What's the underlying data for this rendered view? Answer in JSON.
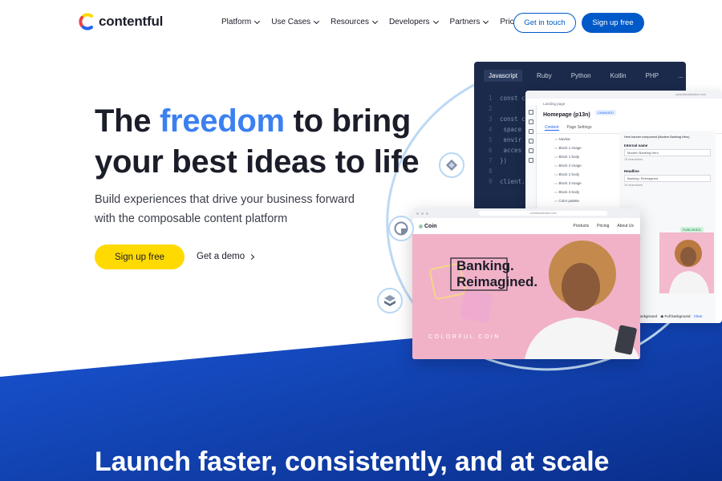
{
  "header": {
    "logo_text": "contentful",
    "nav": [
      {
        "label": "Platform",
        "dropdown": true
      },
      {
        "label": "Use Cases",
        "dropdown": true
      },
      {
        "label": "Resources",
        "dropdown": true
      },
      {
        "label": "Developers",
        "dropdown": true
      },
      {
        "label": "Partners",
        "dropdown": true
      },
      {
        "label": "Pricing",
        "dropdown": false
      }
    ],
    "get_in_touch": "Get in touch",
    "sign_up": "Sign up free"
  },
  "hero": {
    "headline_pre": "The ",
    "headline_highlight": "freedom",
    "headline_post_line1": " to bring",
    "headline_line2": "your best ideas to life",
    "subtext": "Build experiences that drive your business forward with the composable content platform",
    "cta_primary": "Sign up free",
    "cta_secondary": "Get a demo"
  },
  "code_window": {
    "tabs": [
      "Javascript",
      "Ruby",
      "Python",
      "Kotlin",
      "PHP",
      "..."
    ],
    "active_tab": "Javascript",
    "lines": [
      {
        "n": "1",
        "code": "const c"
      },
      {
        "n": "2",
        "code": ""
      },
      {
        "n": "3",
        "code": "const c"
      },
      {
        "n": "4",
        "code": "  space"
      },
      {
        "n": "5",
        "code": "  envir"
      },
      {
        "n": "6",
        "code": "  acces"
      },
      {
        "n": "7",
        "code": "})"
      },
      {
        "n": "8",
        "code": ""
      },
      {
        "n": "9",
        "code": "client."
      }
    ]
  },
  "cms": {
    "url": "colorfulcollective.com",
    "breadcrumb": "Landing page",
    "title": "Homepage (p13n)",
    "badge": "CHANGED",
    "tabs": [
      "Content",
      "Page Settings"
    ],
    "list": [
      "Navbar",
      "Block 1 image",
      "Block 1 body",
      "Block 2 image",
      "Block 2 body",
      "Block 3 image",
      "Block 3 body",
      "Color palette"
    ],
    "component_title": "Hero banner component (Modern Banking Hero)",
    "fields": [
      {
        "label": "Internal name",
        "value": "Modern Banking Hero",
        "hint": "19 characters"
      },
      {
        "label": "Headline",
        "value": "Banking. Reimagined",
        "hint": "19 characters"
      }
    ],
    "published_badge": "PUBLISHED",
    "background_label": "Background",
    "full_background": "Full background",
    "clear": "Clear"
  },
  "coin": {
    "url": "colorfulcollective.com",
    "logo": "Coin",
    "nav": [
      "Products",
      "Pricing",
      "About Us"
    ],
    "headline_line1": "Banking.",
    "headline_line2": "Reimagined.",
    "tagline": "COLORFUL COIN"
  },
  "section2": {
    "title": "Launch faster, consistently, and at scale"
  },
  "colors": {
    "brand_blue": "#0059c8",
    "highlight_blue": "#3c80f0",
    "cta_yellow": "#ffda00",
    "hero_blue_dark": "#0b3a9e",
    "coin_pink": "#f1b2c8"
  }
}
